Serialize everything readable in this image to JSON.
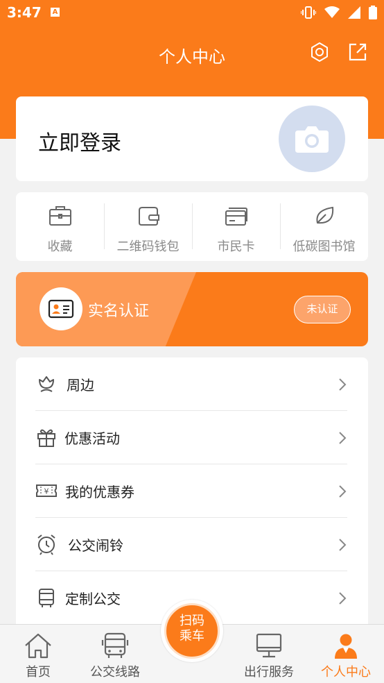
{
  "status_bar": {
    "time": "3:47",
    "notif_letter": "A"
  },
  "header": {
    "title": "个人中心",
    "settings_icon": "settings-icon",
    "share_icon": "share-icon"
  },
  "login": {
    "label": "立即登录"
  },
  "quick_actions": [
    {
      "label": "收藏",
      "icon": "briefcase-icon"
    },
    {
      "label": "二维码钱包",
      "icon": "wallet-icon"
    },
    {
      "label": "市民卡",
      "icon": "card-icon"
    },
    {
      "label": "低碳图书馆",
      "icon": "leaf-icon"
    }
  ],
  "verify": {
    "label": "实名认证",
    "status": "未认证"
  },
  "menu": [
    {
      "label": "周边",
      "icon": "flower-icon"
    },
    {
      "label": "优惠活动",
      "icon": "gift-icon"
    },
    {
      "label": "我的优惠券",
      "icon": "coupon-icon"
    },
    {
      "label": "公交闹铃",
      "icon": "alarm-clock-icon"
    },
    {
      "label": "定制公交",
      "icon": "bus-icon"
    }
  ],
  "tabbar": {
    "items": [
      {
        "label": "首页",
        "icon": "home-icon"
      },
      {
        "label": "公交线路",
        "icon": "bus-route-icon"
      },
      {
        "label": "出行服务",
        "icon": "monitor-icon"
      },
      {
        "label": "个人中心",
        "icon": "person-icon"
      }
    ],
    "scan": {
      "line1": "扫码",
      "line2": "乘车"
    }
  },
  "colors": {
    "accent": "#fb7b1a",
    "accent_light": "#fd9a55",
    "avatar_bg": "#d3ddef"
  }
}
